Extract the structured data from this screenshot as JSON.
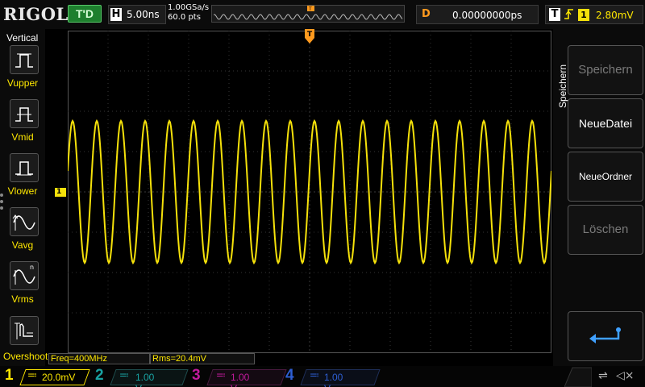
{
  "brand": {
    "logo": "RIGOL"
  },
  "status": {
    "run_state": "T'D"
  },
  "timebase": {
    "badge": "H",
    "value": "5.00ns",
    "sample_rate": "1.00GSa/s",
    "mem_depth": "60.0 pts"
  },
  "delay": {
    "badge": "D",
    "value": "0.00000000ps"
  },
  "trigger": {
    "badge": "T",
    "source": "1",
    "level": "2.80mV"
  },
  "left_menu": {
    "title": "Vertical",
    "items": [
      {
        "label": "Vupper",
        "icon": "vupper-icon"
      },
      {
        "label": "Vmid",
        "icon": "vmid-icon"
      },
      {
        "label": "Vlower",
        "icon": "vlower-icon"
      },
      {
        "label": "Vavg",
        "icon": "vavg-icon"
      },
      {
        "label": "Vrms",
        "icon": "vrms-icon"
      },
      {
        "label": "Overshoot",
        "icon": "overshoot-icon"
      }
    ]
  },
  "right_menu": {
    "title": "Speichern",
    "buttons": [
      {
        "label": "Speichern",
        "enabled": false
      },
      {
        "label": "NeueDatei",
        "enabled": true
      },
      {
        "label": "NeueOrdner",
        "enabled": true
      },
      {
        "label": "Löschen",
        "enabled": false
      }
    ]
  },
  "measurements": {
    "freq": "Freq=400MHz",
    "rms": "Rms=20.4mV"
  },
  "channels": [
    {
      "number": "1",
      "scale": "20.0mV",
      "color": "#ffe800",
      "active": true
    },
    {
      "number": "2",
      "scale": "1.00 V",
      "color": "#19a3a3",
      "active": false
    },
    {
      "number": "3",
      "scale": "1.00 V",
      "color": "#c21a9c",
      "active": false
    },
    {
      "number": "4",
      "scale": "1.00 V",
      "color": "#2e5fd4",
      "active": false
    }
  ],
  "waveform": {
    "color": "#f5e10a",
    "cycles": 20
  },
  "colors": {
    "accent": "#ffe800",
    "trigger_marker": "#ff9a1e",
    "grid": "#3a3a3a"
  }
}
